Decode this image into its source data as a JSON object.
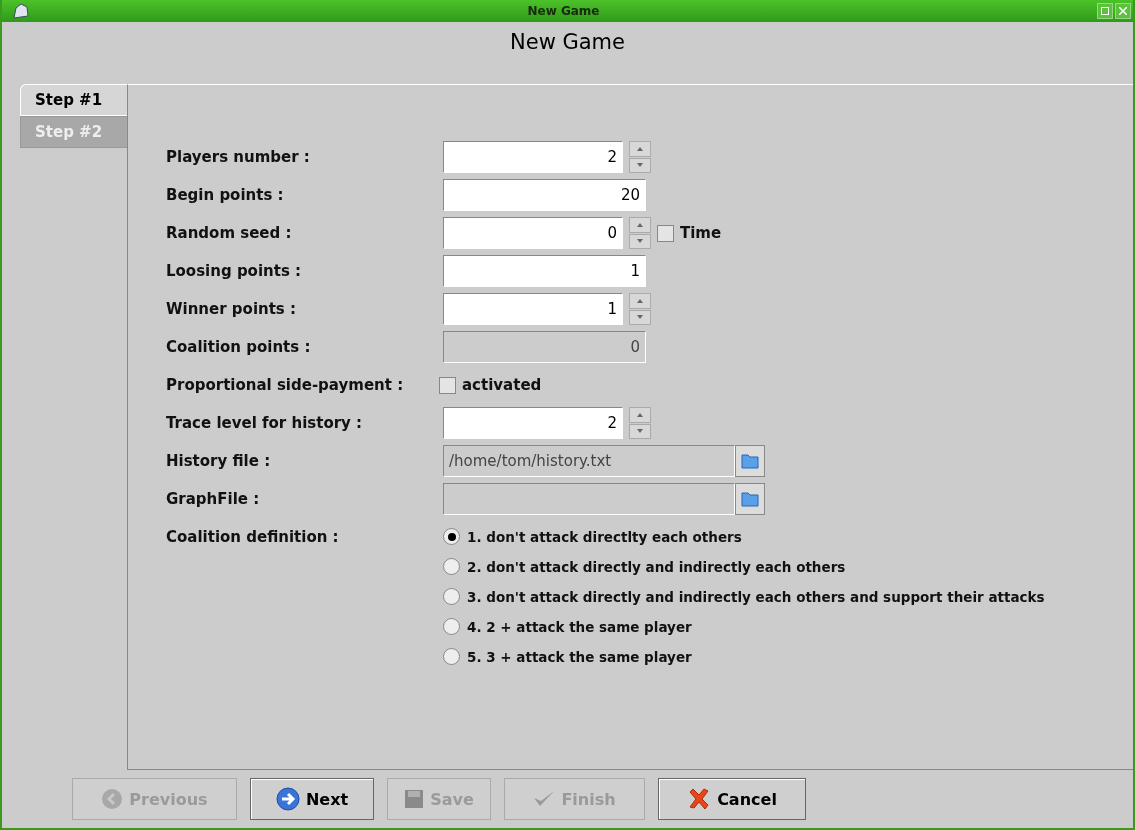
{
  "window": {
    "title": "New Game"
  },
  "heading": "New Game",
  "tabs": [
    {
      "label": "Step #1",
      "selected": true
    },
    {
      "label": "Step #2",
      "selected": false
    }
  ],
  "fields": [
    {
      "kind": "spinner",
      "label": "Players number :",
      "value": "2"
    },
    {
      "kind": "text",
      "label": "Begin points :",
      "value": "20"
    },
    {
      "kind": "spinner",
      "label": "Random seed :",
      "value": "0",
      "checkbox": {
        "label": "Time",
        "checked": false
      }
    },
    {
      "kind": "text",
      "label": "Loosing points :",
      "value": "1"
    },
    {
      "kind": "spinner",
      "label": "Winner points :",
      "value": "1"
    },
    {
      "kind": "text",
      "label": "Coalition points :",
      "value": "0",
      "disabled": true
    },
    {
      "kind": "checkbox",
      "label": "Proportional side-payment :",
      "option": "activated",
      "checked": false
    },
    {
      "kind": "spinner",
      "label": "Trace level for history :",
      "value": "2"
    },
    {
      "kind": "file",
      "label": "History file :",
      "value": "/home/tom/history.txt"
    },
    {
      "kind": "file",
      "label": "GraphFile :"
    },
    {
      "kind": "radio",
      "label": "Coalition definition :",
      "options": [
        {
          "label": "1. don't attack directlty each others",
          "selected": true
        },
        {
          "label": "2. don't attack directly and indirectly each others",
          "selected": false
        },
        {
          "label": "3. don't attack directly and indirectly each others and support their attacks",
          "selected": false
        },
        {
          "label": "4. 2 + attack the same player",
          "selected": false
        },
        {
          "label": "5. 3 + attack the same player",
          "selected": false
        }
      ]
    }
  ],
  "buttons": [
    {
      "kind": "previous",
      "label": "Previous",
      "disabled": true
    },
    {
      "kind": "next",
      "label": "Next",
      "disabled": false
    },
    {
      "kind": "save",
      "label": "Save",
      "disabled": true
    },
    {
      "kind": "finish",
      "label": "Finish",
      "disabled": true
    },
    {
      "kind": "cancel",
      "label": "Cancel",
      "disabled": false
    }
  ]
}
